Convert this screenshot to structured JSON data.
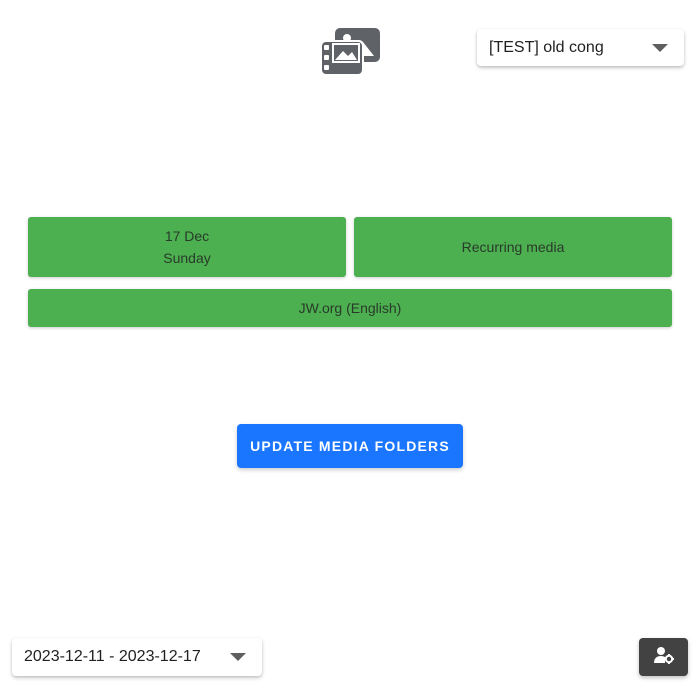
{
  "header": {
    "logo_icon": "media-folders-icon",
    "congregation_select": {
      "value": "[TEST] old cong",
      "icon": "chevron-down-icon"
    }
  },
  "tiles": {
    "date": {
      "day": "17 Dec",
      "weekday": "Sunday"
    },
    "recurring": {
      "label": "Recurring media"
    },
    "jw": {
      "label": "JW.org (English)"
    },
    "color": "#4caf50"
  },
  "actions": {
    "update_label": "UPDATE MEDIA FOLDERS",
    "update_color": "#1b76ff"
  },
  "footer": {
    "date_range_select": {
      "value": "2023-12-11 - 2023-12-17",
      "icon": "chevron-down-icon"
    },
    "settings_icon": "user-cog-icon"
  }
}
